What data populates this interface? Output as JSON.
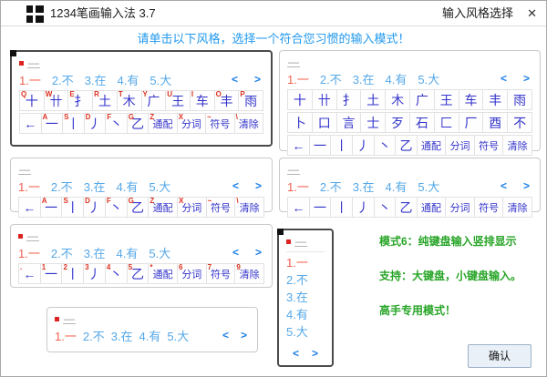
{
  "window": {
    "title": "1234笔画输入法 3.7",
    "dialog_title": "输入风格选择",
    "close_glyph": "✕"
  },
  "instruction": "请单击以下风格，选择一个符合您习惯的输入模式！",
  "preedit": "—",
  "candidates": {
    "items": [
      "1.一",
      "2.不",
      "3.在",
      "4.有",
      "5.大"
    ],
    "prev": "<",
    "next": ">"
  },
  "keyboards": {
    "letter_row1": [
      {
        "label": "Q",
        "char": "十"
      },
      {
        "label": "W",
        "char": "卄"
      },
      {
        "label": "E",
        "char": "扌"
      },
      {
        "label": "R",
        "char": "土"
      },
      {
        "label": "T",
        "char": "木"
      },
      {
        "label": "Y",
        "char": "广"
      },
      {
        "label": "U",
        "char": "王"
      },
      {
        "label": "I",
        "char": "车"
      },
      {
        "label": "O",
        "char": "丰"
      },
      {
        "label": "P",
        "char": "雨"
      }
    ],
    "letter_row2": [
      {
        "char": "←",
        "name": "backspace-key"
      },
      {
        "label": "A",
        "char": "一"
      },
      {
        "label": "S",
        "char": "丨"
      },
      {
        "label": "D",
        "char": "丿"
      },
      {
        "label": "F",
        "char": "丶"
      },
      {
        "label": "G",
        "char": "乙"
      },
      {
        "label": "Z",
        "char": "通配",
        "fn": true,
        "name": "wildcard-key"
      },
      {
        "label": "X",
        "char": "分词",
        "fn": true,
        "name": "segment-key"
      },
      {
        "label": "~",
        "char": "符号",
        "fn": true,
        "name": "symbol-key"
      },
      {
        "label": "\\",
        "char": "清除",
        "fn": true,
        "name": "clear-key"
      }
    ],
    "plain_row1": [
      {
        "char": "十"
      },
      {
        "char": "卄"
      },
      {
        "char": "扌"
      },
      {
        "char": "土"
      },
      {
        "char": "木"
      },
      {
        "char": "广"
      },
      {
        "char": "王"
      },
      {
        "char": "车"
      },
      {
        "char": "丰"
      },
      {
        "char": "雨"
      }
    ],
    "plain_row2": [
      {
        "char": "卜"
      },
      {
        "char": "口"
      },
      {
        "char": "言"
      },
      {
        "char": "士"
      },
      {
        "char": "歹"
      },
      {
        "char": "石"
      },
      {
        "char": "匚"
      },
      {
        "char": "厂"
      },
      {
        "char": "酉"
      },
      {
        "char": "不"
      }
    ],
    "plain_row3": [
      {
        "char": "←",
        "name": "backspace-key"
      },
      {
        "char": "一"
      },
      {
        "char": "丨"
      },
      {
        "char": "丿"
      },
      {
        "char": "丶"
      },
      {
        "char": "乙"
      },
      {
        "char": "通配",
        "fn": true,
        "name": "wildcard-key"
      },
      {
        "char": "分词",
        "fn": true,
        "name": "segment-key"
      },
      {
        "char": "符号",
        "fn": true,
        "name": "symbol-key"
      },
      {
        "char": "清除",
        "fn": true,
        "name": "clear-key"
      }
    ],
    "numeric_row": [
      {
        "label": ".",
        "char": "←",
        "name": "backspace-key"
      },
      {
        "label": "1",
        "char": "一"
      },
      {
        "label": "2",
        "char": "丨"
      },
      {
        "label": "3",
        "char": "丿"
      },
      {
        "label": "4",
        "char": "丶"
      },
      {
        "label": "5",
        "char": "乙"
      },
      {
        "label": "*",
        "char": "通配",
        "fn": true,
        "name": "wildcard-key"
      },
      {
        "label": "6",
        "char": "分词",
        "fn": true,
        "name": "segment-key"
      },
      {
        "label": "7",
        "char": "符号",
        "fn": true,
        "name": "symbol-key"
      },
      {
        "label": "9",
        "char": "清除",
        "fn": true,
        "name": "clear-key"
      }
    ]
  },
  "mode6_info": [
    "模式6：纯键盘输入竖排显示",
    "支持：大键盘，小键盘输入。",
    "高手专用模式！"
  ],
  "confirm_label": "确认",
  "colors": {
    "instruction_blue": "#2299ee",
    "candidate_blue": "#55a8e8",
    "candidate_first_red": "#f4604f",
    "key_char_blue": "#3333cc",
    "key_label_red": "#dd3322",
    "note_green": "#27a527",
    "selected_border": "#4a4a4a"
  }
}
